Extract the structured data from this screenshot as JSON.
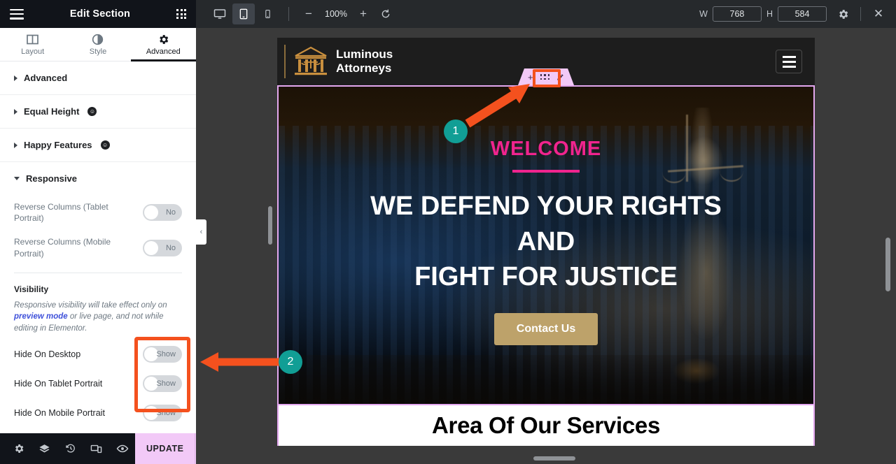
{
  "panel": {
    "title": "Edit Section",
    "menu_icon": "hamburger-icon",
    "apps_icon": "grid-apps-icon",
    "tabs": [
      {
        "label": "Layout",
        "icon": "layout-columns-icon",
        "active": false
      },
      {
        "label": "Style",
        "icon": "contrast-half-circle-icon",
        "active": false
      },
      {
        "label": "Advanced",
        "icon": "gear-icon",
        "active": true
      }
    ],
    "sections": [
      {
        "label": "Advanced",
        "expanded": false,
        "pro": false
      },
      {
        "label": "Equal Height",
        "expanded": false,
        "pro": true,
        "pro_glyph": "☺"
      },
      {
        "label": "Happy Features",
        "expanded": false,
        "pro": true,
        "pro_glyph": "☺"
      },
      {
        "label": "Responsive",
        "expanded": true,
        "pro": false
      }
    ],
    "responsive": {
      "controls": [
        {
          "label": "Reverse Columns (Tablet Portrait)",
          "value": "No"
        },
        {
          "label": "Reverse Columns (Mobile Portrait)",
          "value": "No"
        }
      ],
      "visibility": {
        "title": "Visibility",
        "helper_pre": "Responsive visibility will take effect only on ",
        "helper_link": "preview mode",
        "helper_post": " or live page, and not while editing in Elementor.",
        "rows": [
          {
            "label": "Hide On Desktop",
            "value": "Show"
          },
          {
            "label": "Hide On Tablet Portrait",
            "value": "Show"
          },
          {
            "label": "Hide On Mobile Portrait",
            "value": "Show"
          }
        ]
      }
    },
    "footer": {
      "icons": [
        "gear-icon",
        "layers-icon",
        "history-clock-icon",
        "responsive-devices-icon",
        "eye-preview-icon"
      ],
      "update_label": "UPDATE",
      "caret_glyph": "⌃"
    },
    "collapse_glyph": "‹"
  },
  "topbar": {
    "devices": [
      {
        "name": "desktop",
        "active": false
      },
      {
        "name": "tablet",
        "active": true
      },
      {
        "name": "mobile",
        "active": false
      }
    ],
    "zoom_out_glyph": "−",
    "zoom_value": "100%",
    "zoom_in_glyph": "+",
    "reset_glyph": "↺",
    "width_label": "W",
    "width_value": "768",
    "height_label": "H",
    "height_value": "584",
    "settings_icon": "gear-icon",
    "close_glyph": "✕"
  },
  "preview": {
    "site_header": {
      "logo_icon": "courthouse-scales-icon",
      "logo_line1": "Luminous",
      "logo_line2": "Attorneys",
      "menu_icon": "hamburger-menu-icon"
    },
    "section_handle": {
      "add_glyph": "+",
      "drag_icon": "six-dots-drag-icon",
      "edit_glyph": "✐"
    },
    "hero": {
      "eyebrow": "WELCOME",
      "headline_line1": "WE DEFEND YOUR RIGHTS",
      "headline_line2": "AND",
      "headline_line3": "FIGHT FOR JUSTICE",
      "cta_label": "Contact Us",
      "eyebrow_color": "#f0248e",
      "cta_color": "#bda26a"
    },
    "services_heading": "Area Of Our Services"
  },
  "annotations": {
    "accent_color": "#f4511e",
    "badge_color": "#119e95",
    "badges": [
      {
        "number": "1"
      },
      {
        "number": "2"
      }
    ]
  }
}
